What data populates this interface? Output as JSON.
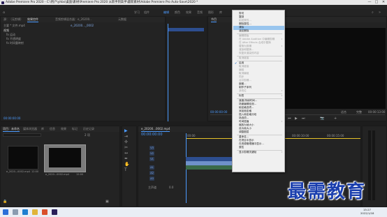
{
  "window": {
    "title": "Adobe Premiere Pro 2020 - C:\\用户\\yhbs\\桌面\\素材\\Premiere Pro 2020 从新手到高手\\最新素材\\Adobe Premiere Pro Auto-Save\\2020 *",
    "minimize": "—",
    "maximize": "□",
    "close": "✕"
  },
  "menubar": [
    "文件(F)",
    "编辑(E)",
    "剪辑(C)",
    "序列(S)",
    "标记(M)",
    "图形(G)",
    "视图(V)",
    "窗口(W)",
    "帮助(H)"
  ],
  "workspaces": [
    {
      "label": "学习",
      "active": false
    },
    {
      "label": "组件",
      "active": false
    },
    {
      "label": "编辑",
      "active": true
    },
    {
      "label": "颜色",
      "active": false
    },
    {
      "label": "效果",
      "active": false
    },
    {
      "label": "音频",
      "active": false
    },
    {
      "label": "图形",
      "active": false
    },
    {
      "label": "库",
      "active": false
    }
  ],
  "source_panel": {
    "tabs": [
      "源：（无剪辑）",
      "效果控件",
      "音频剪辑混合器：e_20200..",
      "元数据"
    ],
    "header_left": "主要 * 文件.mp4",
    "header_right": "e_20200..._0002",
    "rows": [
      "视频",
      "fx 运动",
      "fx 不透明度",
      "fx 时间重映射"
    ],
    "timecode": "00:00:00:00"
  },
  "program_panel": {
    "label": "节目",
    "fit": "适合",
    "timecode_left": "00:00:00:00",
    "timecode_right": "00:00:13:00",
    "quality": "完整"
  },
  "project_panel": {
    "tabs": [
      "项目：未命名",
      "媒体浏览器",
      "库",
      "信息",
      "效果",
      "标记",
      "历史记录"
    ],
    "search_placeholder": "",
    "item_count": "2 项",
    "items": [
      {
        "name": "e_2020...0002.mp4",
        "duration": "12:00"
      },
      {
        "name": "e_2020...0002.mp4",
        "duration": "12:00"
      }
    ]
  },
  "timeline": {
    "tab": "e_20200...0002.mp4",
    "timecode": "00:00:00:00",
    "ruler": [
      "00:00",
      "00:00:05:00",
      "00:00:10:00",
      "00:00:15:00",
      "00:00:20:00"
    ],
    "tracks": [
      "V3",
      "V2",
      "V1",
      "A1",
      "A2",
      "A3"
    ],
    "master": "主声道",
    "master_value": "0.0"
  },
  "context_menu": {
    "items": [
      {
        "label": "剪切",
        "state": "normal"
      },
      {
        "label": "复制",
        "state": "normal"
      },
      {
        "label": "粘贴属性...",
        "state": "disabled"
      },
      {
        "label": "删除属性...",
        "state": "normal"
      },
      {
        "label": "清除",
        "state": "highlighted"
      },
      {
        "label": "波纹删除",
        "state": "normal"
      },
      {
        "sep": true
      },
      {
        "label": "编辑原始",
        "state": "disabled"
      },
      {
        "label": "在 Adobe Audition 中编辑剪辑",
        "state": "disabled",
        "submenu": true
      },
      {
        "label": "在 After Effects 合成中替换",
        "state": "disabled"
      },
      {
        "label": "替换为剪辑",
        "state": "disabled",
        "submenu": true
      },
      {
        "label": "渲染和替换...",
        "state": "disabled"
      },
      {
        "label": "恢复未渲染的内容",
        "state": "disabled"
      },
      {
        "sep": true
      },
      {
        "label": "取消链接",
        "state": "disabled"
      },
      {
        "sep": true
      },
      {
        "label": "启用",
        "state": "normal",
        "checked": true
      },
      {
        "label": "取消链接",
        "state": "disabled"
      },
      {
        "label": "编组",
        "state": "disabled"
      },
      {
        "label": "取消编组",
        "state": "disabled"
      },
      {
        "label": "同步",
        "state": "disabled"
      },
      {
        "label": "合并剪辑...",
        "state": "disabled"
      },
      {
        "label": "嵌套...",
        "state": "normal"
      },
      {
        "label": "制作子序列",
        "state": "normal"
      },
      {
        "label": "多机位",
        "state": "disabled",
        "submenu": true
      },
      {
        "sep": true
      },
      {
        "label": "标签",
        "state": "normal",
        "submenu": true
      },
      {
        "sep": true
      },
      {
        "label": "速度/持续时间...",
        "state": "normal"
      },
      {
        "label": "场景编辑检测...",
        "state": "normal"
      },
      {
        "label": "帧定格选项...",
        "state": "normal"
      },
      {
        "label": "添加帧定格",
        "state": "normal"
      },
      {
        "label": "插入帧定格分段",
        "state": "normal"
      },
      {
        "label": "场选项...",
        "state": "normal"
      },
      {
        "label": "时间插值",
        "state": "normal",
        "submenu": true
      },
      {
        "label": "缩放为帧大小",
        "state": "normal"
      },
      {
        "label": "设为帧大小",
        "state": "normal"
      },
      {
        "label": "调整图层",
        "state": "normal"
      },
      {
        "sep": true
      },
      {
        "label": "重命名...",
        "state": "normal"
      },
      {
        "label": "在项目中显示",
        "state": "normal"
      },
      {
        "label": "在资源管理器中显示...",
        "state": "normal"
      },
      {
        "label": "属性",
        "state": "normal"
      },
      {
        "sep": true
      },
      {
        "label": "显示剪辑关键帧",
        "state": "normal",
        "submenu": true
      }
    ]
  },
  "taskbar": {
    "time": "15:27",
    "date": "2022/1/18"
  },
  "watermark": "最需教育",
  "colors": {
    "accent": "#4c9bff",
    "clip": "#2d4e8f",
    "menu_highlight": "#99c5ee",
    "watermark": "#1b3fae"
  }
}
